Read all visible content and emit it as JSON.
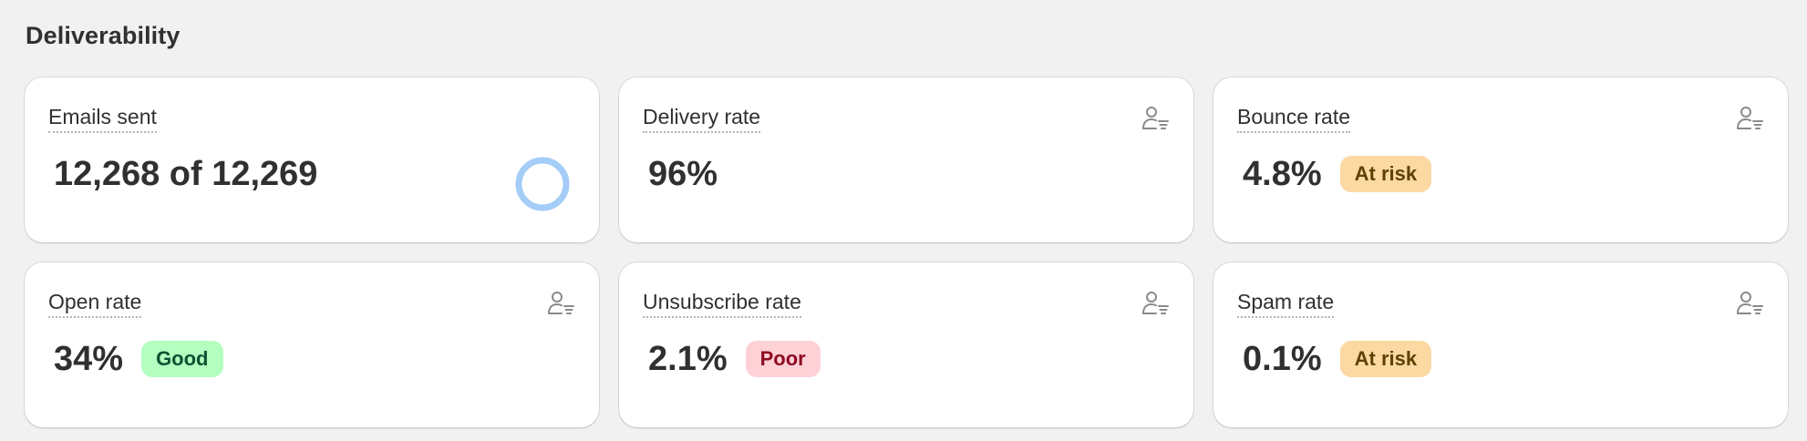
{
  "section": {
    "title": "Deliverability"
  },
  "colors": {
    "background": "#f1f1f1",
    "card": "#ffffff",
    "progress_ring": "#a4cdf7",
    "badge_at_risk": "#fcd9a3",
    "badge_good": "#b4fec0",
    "badge_poor": "#fed1d7"
  },
  "cards": [
    {
      "label": "Emails sent",
      "value": "12,268 of 12,269",
      "progress": {
        "sent": 12268,
        "total": 12269
      }
    },
    {
      "label": "Delivery rate",
      "value": "96%",
      "icon": "customer-segment-icon"
    },
    {
      "label": "Bounce rate",
      "value": "4.8%",
      "badge": "At risk",
      "icon": "customer-segment-icon"
    },
    {
      "label": "Open rate",
      "value": "34%",
      "badge": "Good",
      "icon": "customer-segment-icon"
    },
    {
      "label": "Unsubscribe rate",
      "value": "2.1%",
      "badge": "Poor",
      "icon": "customer-segment-icon"
    },
    {
      "label": "Spam rate",
      "value": "0.1%",
      "badge": "At risk",
      "icon": "customer-segment-icon"
    }
  ]
}
